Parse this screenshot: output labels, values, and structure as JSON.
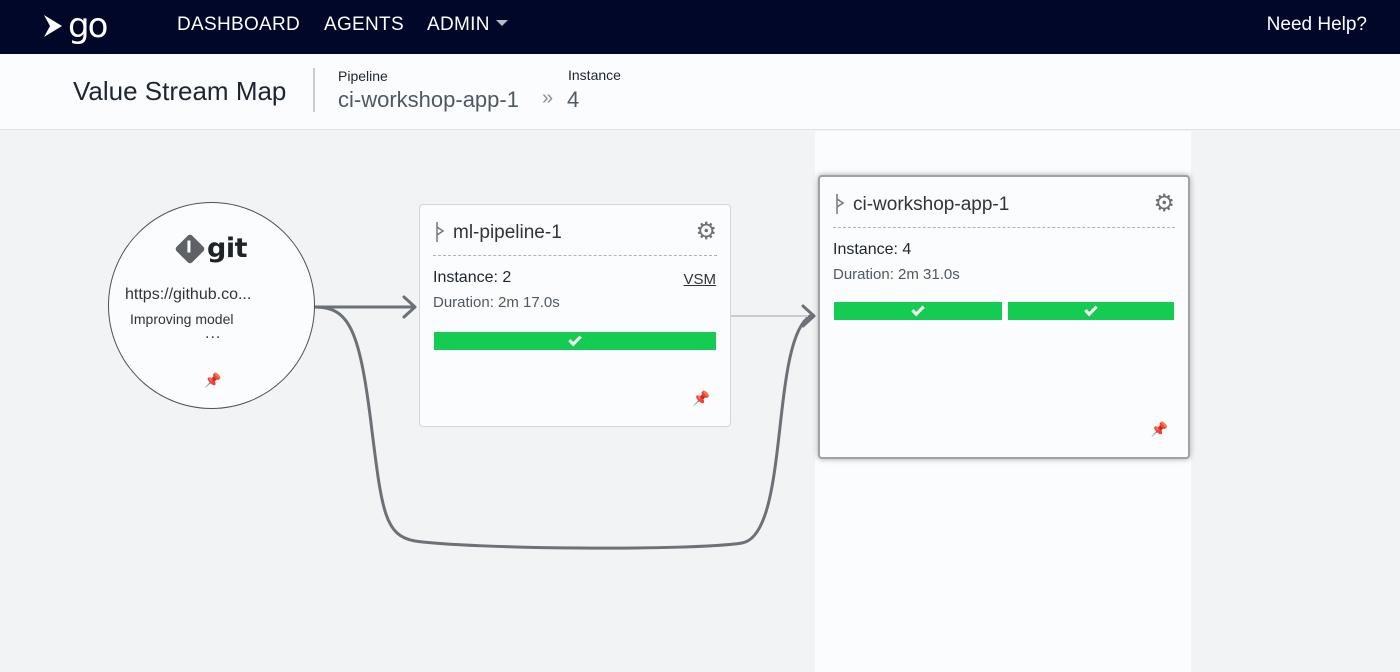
{
  "nav": {
    "logo": "go",
    "items": [
      {
        "label": "DASHBOARD"
      },
      {
        "label": "AGENTS"
      },
      {
        "label": "ADMIN"
      }
    ],
    "help": "Need Help?"
  },
  "header": {
    "title": "Value Stream Map",
    "pipeline_label": "Pipeline",
    "pipeline_value": "ci-workshop-app-1",
    "separator": "»",
    "instance_label": "Instance",
    "instance_value": "4"
  },
  "material": {
    "type_label": "git",
    "url": "https://github.co...",
    "comment": "Improving model",
    "more": "..."
  },
  "pipelines": [
    {
      "name": "ml-pipeline-1",
      "instance": "Instance: 2",
      "duration": "Duration: 2m 17.0s",
      "vsm_link": "VSM",
      "stages": [
        {
          "status": "passed"
        }
      ]
    },
    {
      "name": "ci-workshop-app-1",
      "instance": "Instance: 4",
      "duration": "Duration: 2m 31.0s",
      "stages": [
        {
          "status": "passed"
        },
        {
          "status": "passed"
        }
      ],
      "current": true
    }
  ],
  "colors": {
    "nav_bg": "#000728",
    "stage_passed": "#14cc52",
    "link_line": "#6b7177"
  },
  "icons": [
    "git-icon",
    "pipeline-icon",
    "gear-icon",
    "pin-icon",
    "check-icon",
    "chevron-down-icon"
  ]
}
